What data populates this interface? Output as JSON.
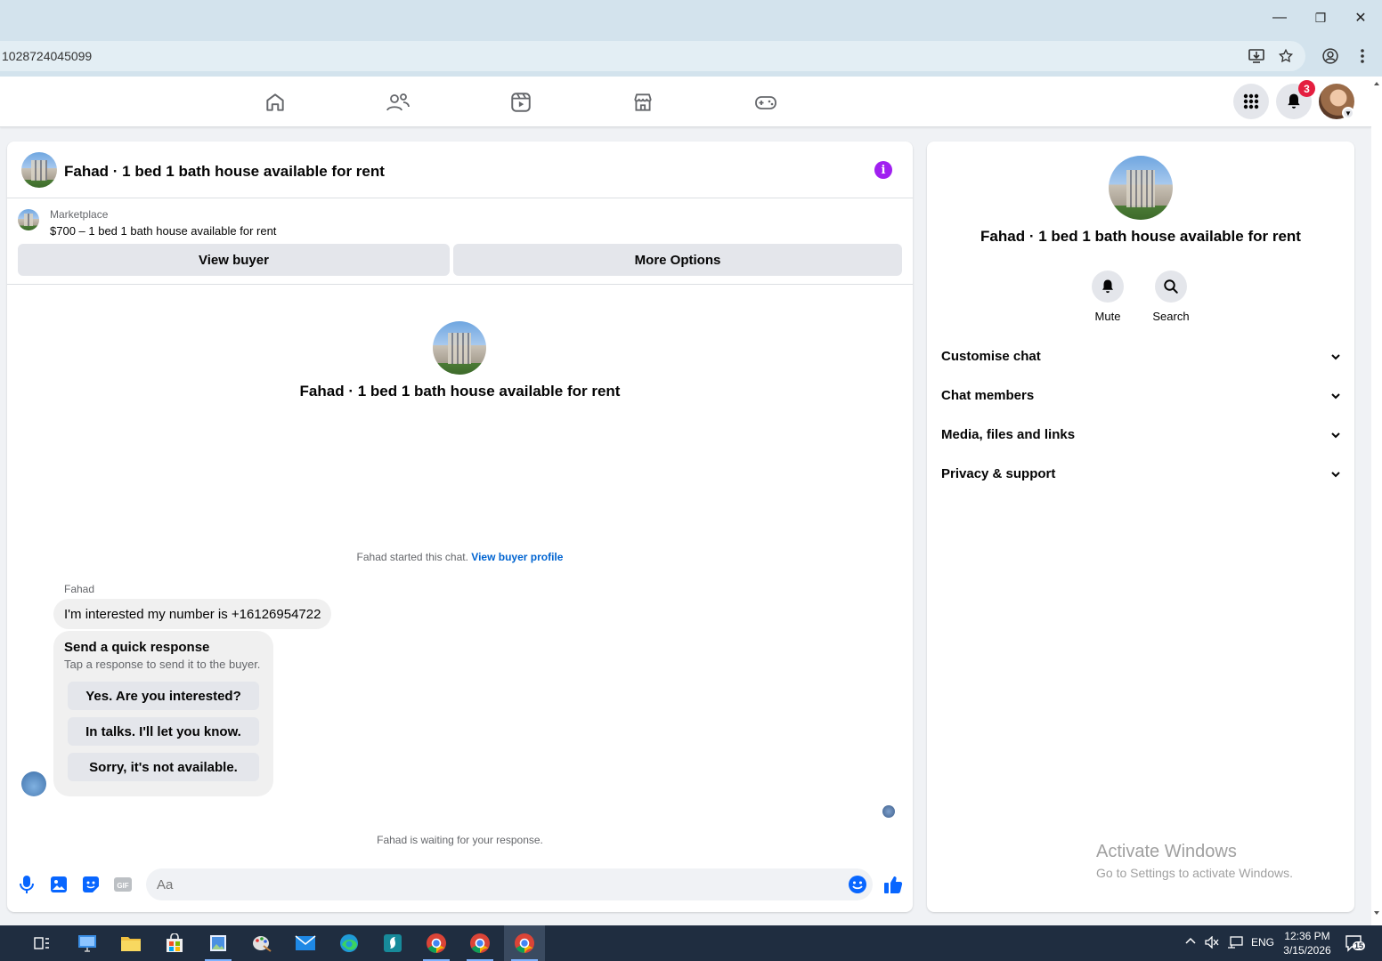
{
  "browser": {
    "url": "1028724045099",
    "window_controls": {
      "minimize": "—",
      "restore": "❐",
      "close": "✕"
    }
  },
  "nav": {
    "notification_count": "3"
  },
  "chat": {
    "title": "Fahad · 1 bed 1 bath house available for rent",
    "listing_source": "Marketplace",
    "listing_summary": "$700 – 1 bed 1 bath house available for rent",
    "view_buyer_label": "View buyer",
    "more_options_label": "More Options",
    "center_name": "Fahad · 1 bed 1 bath house available for rent",
    "started_text": "Fahad started this chat.",
    "view_buyer_profile_link": "View buyer profile",
    "sender_name": "Fahad",
    "message": "I'm interested my number is +16126954722",
    "quick_response": {
      "title": "Send a quick response",
      "subtitle": "Tap a response to send it to the buyer.",
      "options": [
        "Yes. Are you interested?",
        "In talks. I'll let you know.",
        "Sorry, it's not available."
      ]
    },
    "waiting_text": "Fahad is waiting for your response.",
    "composer_placeholder": "Aa"
  },
  "details": {
    "name": "Fahad · 1 bed 1 bath house available for rent",
    "actions": [
      {
        "label": "Mute",
        "icon": "bell-icon"
      },
      {
        "label": "Search",
        "icon": "search-icon"
      }
    ],
    "sections": [
      "Customise chat",
      "Chat members",
      "Media, files and links",
      "Privacy & support"
    ]
  },
  "watermark": {
    "line1": "Activate Windows",
    "line2": "Go to Settings to activate Windows."
  },
  "taskbar": {
    "language": "ENG",
    "time": "12:36 PM",
    "date": "3/15/2026",
    "notification_count": "15"
  },
  "colors": {
    "accent_blue": "#0866ff",
    "info_purple": "#a020f0",
    "badge_red": "#e41e3f"
  }
}
